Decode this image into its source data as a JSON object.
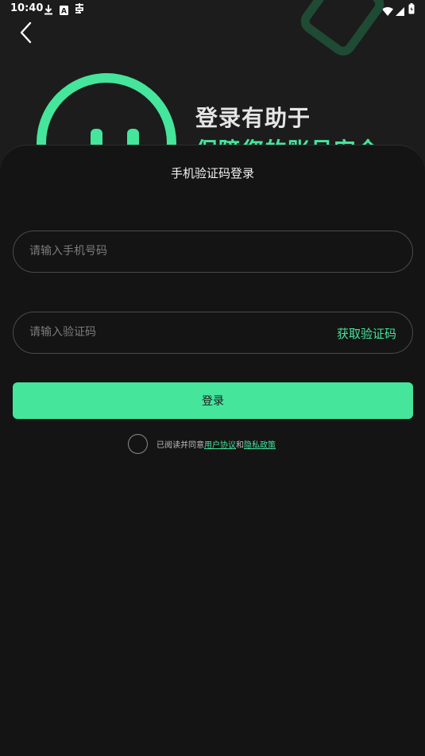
{
  "status_bar": {
    "time": "10:40",
    "left_icons": [
      "download-icon",
      "a-box-icon",
      "notification-app-icon"
    ],
    "right_icons": [
      "wifi-icon",
      "signal-icon",
      "battery-icon"
    ]
  },
  "header": {
    "headline_line1": "登录有助于",
    "headline_line2": "保障您的账号安全"
  },
  "sheet": {
    "title": "手机验证码登录",
    "phone_placeholder": "请输入手机号码",
    "code_placeholder": "请输入验证码",
    "get_code_label": "获取验证码",
    "login_label": "登录",
    "agreement": {
      "prefix": "已阅读并同意",
      "user_agreement": "用户协议",
      "joiner": "和",
      "privacy_policy": "隐私政策"
    }
  },
  "colors": {
    "accent": "#45e59b",
    "background": "#1c1c1c",
    "sheet": "#141414"
  }
}
